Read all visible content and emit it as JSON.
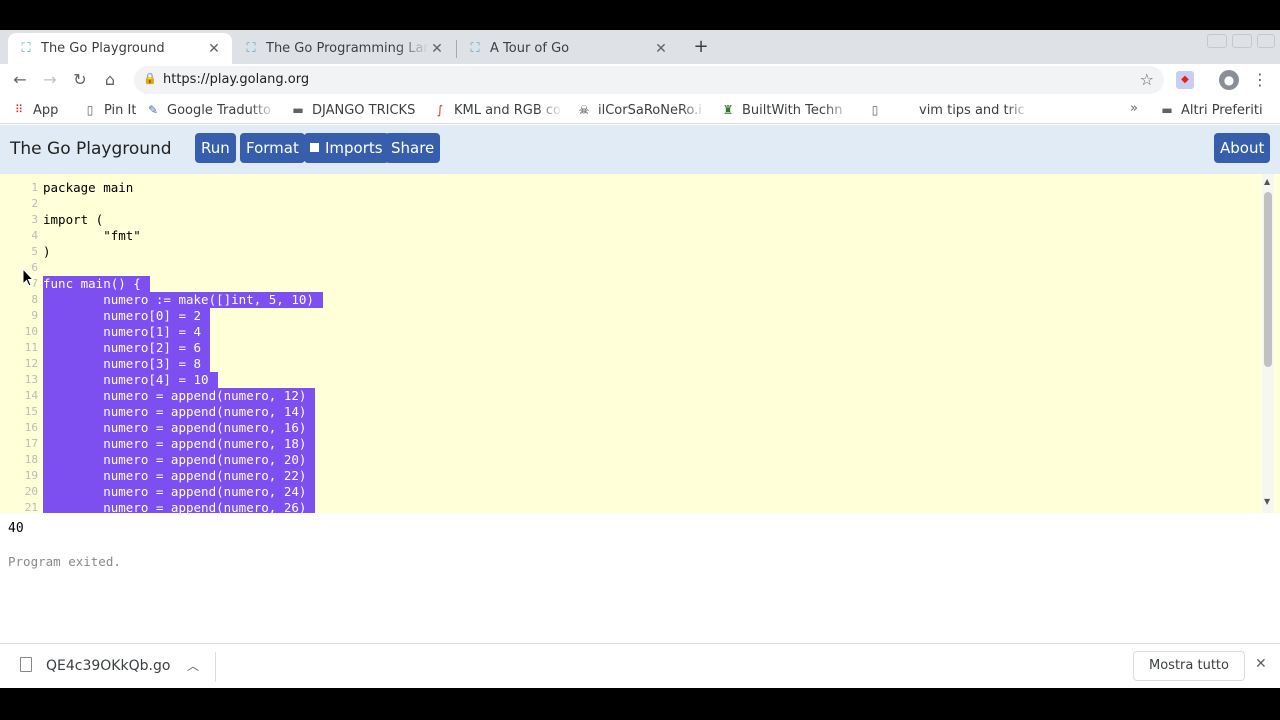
{
  "browser": {
    "tabs": [
      {
        "title": "The Go Playground",
        "active": true
      },
      {
        "title": "The Go Programming Lan",
        "active": false
      },
      {
        "title": "A Tour of Go",
        "active": false
      }
    ],
    "url": "https://play.golang.org",
    "bookmarks": [
      {
        "label": "App",
        "icon": "apps-grid-icon"
      },
      {
        "label": "Pin It",
        "icon": "page-icon"
      },
      {
        "label": "Google Tradutto",
        "icon": "translate-icon"
      },
      {
        "label": "DJANGO TRICKS",
        "icon": "folder-icon"
      },
      {
        "label": "KML and RGB co",
        "icon": "swoosh-icon"
      },
      {
        "label": "ilCorSaRoNeRo.i",
        "icon": "pirate-icon"
      },
      {
        "label": "BuiltWith Techn",
        "icon": "builtwith-icon"
      },
      {
        "label": "",
        "icon": "page-icon"
      },
      {
        "label": "vim tips and tric",
        "icon": ""
      }
    ],
    "bookmarks_more": "»",
    "other_bookmarks": "Altri Preferiti"
  },
  "playground": {
    "title": "The Go Playground",
    "buttons": {
      "run": "Run",
      "format": "Format",
      "imports": "Imports",
      "share": "Share",
      "about": "About"
    }
  },
  "editor": {
    "lines": [
      {
        "n": "1",
        "text": "package main",
        "selected": false
      },
      {
        "n": "2",
        "text": "",
        "selected": false
      },
      {
        "n": "3",
        "text": "import (",
        "selected": false
      },
      {
        "n": "4",
        "text": "        \"fmt\"",
        "selected": false
      },
      {
        "n": "5",
        "text": ")",
        "selected": false
      },
      {
        "n": "6",
        "text": "",
        "selected": true
      },
      {
        "n": "7",
        "text": "func main() {",
        "selected": true
      },
      {
        "n": "8",
        "text": "        numero := make([]int, 5, 10)",
        "selected": true
      },
      {
        "n": "9",
        "text": "        numero[0] = 2",
        "selected": true
      },
      {
        "n": "10",
        "text": "        numero[1] = 4",
        "selected": true
      },
      {
        "n": "11",
        "text": "        numero[2] = 6",
        "selected": true
      },
      {
        "n": "12",
        "text": "        numero[3] = 8",
        "selected": true
      },
      {
        "n": "13",
        "text": "        numero[4] = 10",
        "selected": true
      },
      {
        "n": "14",
        "text": "        numero = append(numero, 12)",
        "selected": true
      },
      {
        "n": "15",
        "text": "        numero = append(numero, 14)",
        "selected": true
      },
      {
        "n": "16",
        "text": "        numero = append(numero, 16)",
        "selected": true
      },
      {
        "n": "17",
        "text": "        numero = append(numero, 18)",
        "selected": true
      },
      {
        "n": "18",
        "text": "        numero = append(numero, 20)",
        "selected": true
      },
      {
        "n": "19",
        "text": "        numero = append(numero, 22)",
        "selected": true
      },
      {
        "n": "20",
        "text": "        numero = append(numero, 24)",
        "selected": true
      },
      {
        "n": "21",
        "text": "        numero = append(numero, 26)",
        "selected": true
      }
    ]
  },
  "output": {
    "result": "40",
    "exit_message": "Program exited."
  },
  "downloads": {
    "file_name": "QE4c39OKkQb.go",
    "show_all": "Mostra tutto"
  }
}
